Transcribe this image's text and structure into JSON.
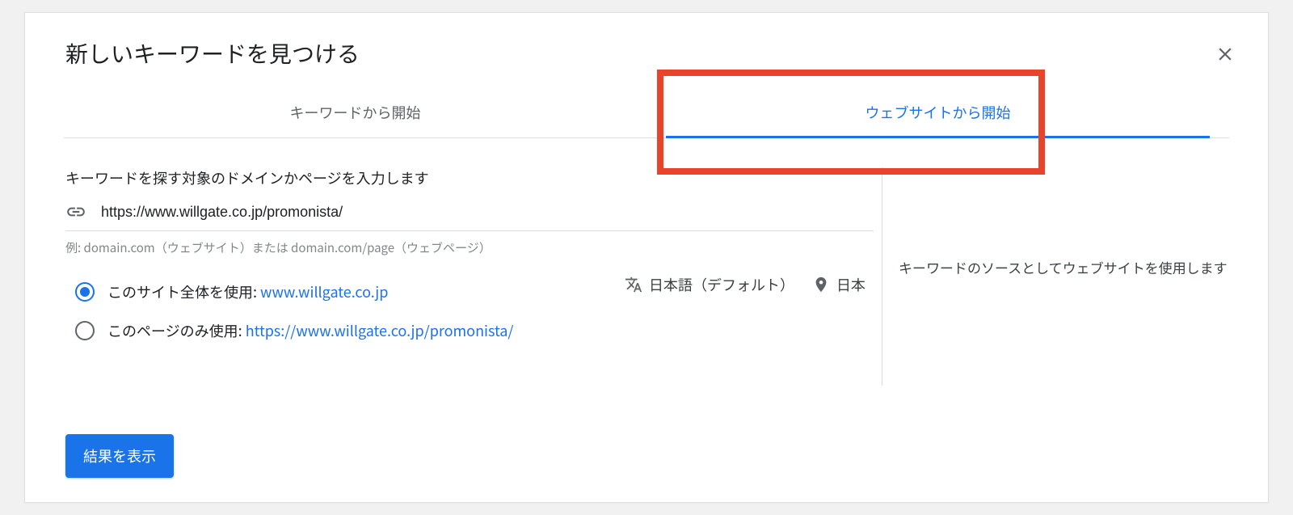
{
  "header": {
    "title": "新しいキーワードを見つける"
  },
  "tabs": {
    "keyword": "キーワードから開始",
    "website": "ウェブサイトから開始"
  },
  "form": {
    "prompt": "キーワードを探す対象のドメインかページを入力します",
    "url_value": "https://www.willgate.co.jp/promonista/",
    "example": "例: domain.com（ウェブサイト）または domain.com/page（ウェブページ）"
  },
  "locale": {
    "language": "日本語（デフォルト）",
    "location": "日本"
  },
  "radios": {
    "option1_label": "このサイト全体を使用: ",
    "option1_link": "www.willgate.co.jp",
    "option2_label": "このページのみ使用: ",
    "option2_link": "https://www.willgate.co.jp/promonista/"
  },
  "sidebar": {
    "info": "キーワードのソースとしてウェブサイトを使用します"
  },
  "actions": {
    "submit": "結果を表示"
  }
}
